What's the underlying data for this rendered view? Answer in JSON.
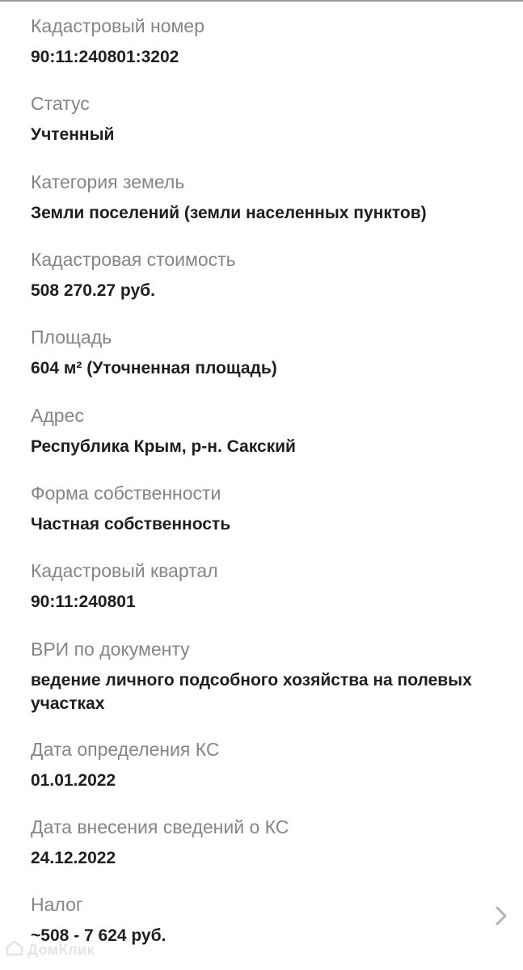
{
  "fields": [
    {
      "label": "Кадастровый номер",
      "value": "90:11:240801:3202"
    },
    {
      "label": "Статус",
      "value": "Учтенный"
    },
    {
      "label": "Категория земель",
      "value": "Земли поселений (земли населенных пунктов)"
    },
    {
      "label": "Кадастровая стоимость",
      "value": "508 270.27 руб."
    },
    {
      "label": "Площадь",
      "value": "604 м² (Уточненная площадь)"
    },
    {
      "label": "Адрес",
      "value": "Республика Крым, р-н. Сакский"
    },
    {
      "label": "Форма собственности",
      "value": "Частная собственность"
    },
    {
      "label": "Кадастровый квартал",
      "value": "90:11:240801"
    },
    {
      "label": "ВРИ по документу",
      "value": "ведение личного подсобного хозяйства на полевых участках"
    },
    {
      "label": "Дата определения КС",
      "value": "01.01.2022"
    },
    {
      "label": "Дата внесения сведений о КС",
      "value": "24.12.2022"
    },
    {
      "label": "Налог",
      "value": "~508 - 7 624 руб."
    }
  ],
  "watermark": {
    "text": "ДомКлик",
    "icon": "domclick-logo-icon"
  },
  "tax_chevron_icon": "chevron-right-icon"
}
